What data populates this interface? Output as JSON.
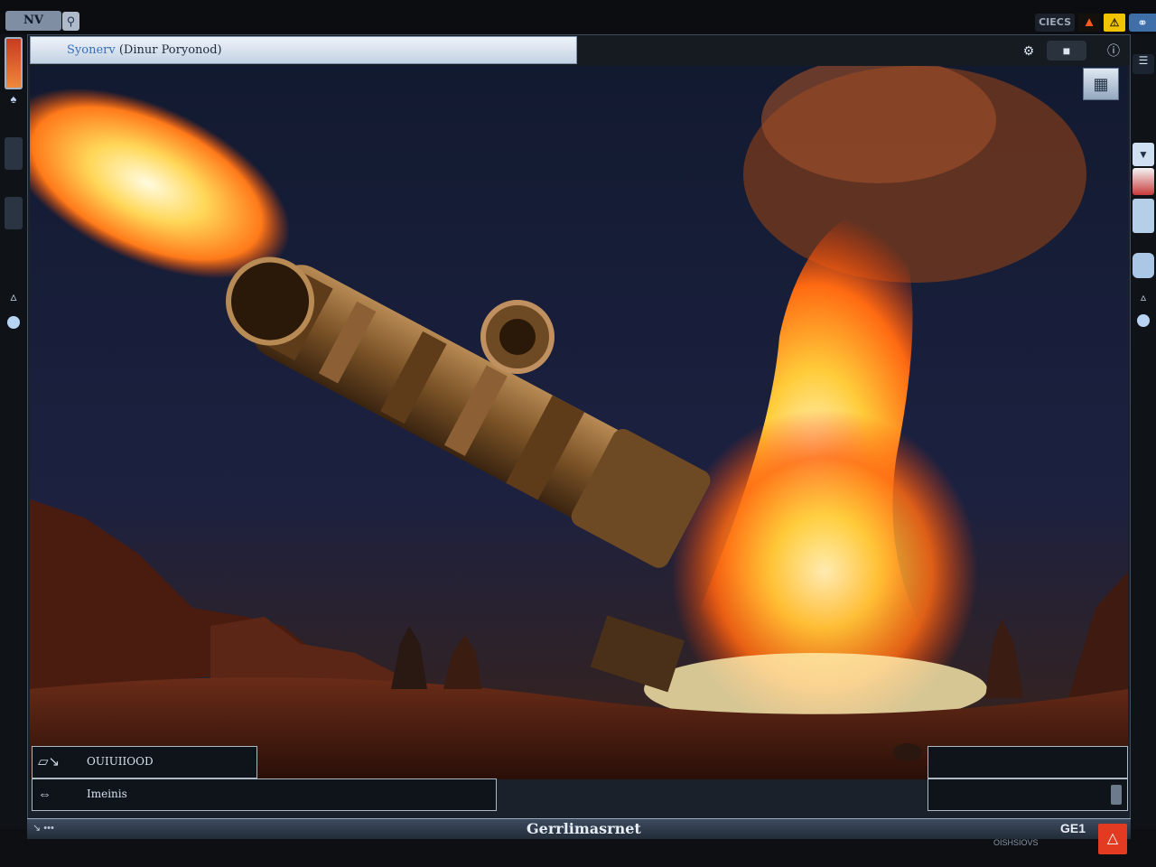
{
  "topbar": {
    "logo_text": "NV",
    "search_icon": "search-icon",
    "tray": {
      "label": "CIECS",
      "fire_icon": "fire-icon",
      "warning_icon": "warning-icon",
      "globe_icon": "globe-icon"
    }
  },
  "left_dock": {
    "items": [
      "app-icon",
      "user-icon",
      "panel-slot",
      "panel-slot",
      "hat-icon",
      "bubble-icon"
    ]
  },
  "window": {
    "tab_title_app": "Syonerv",
    "tab_title_doc": "(Dinur Poryonod)",
    "controls": [
      "settings-icon",
      "window-mode-icon",
      "info-icon"
    ]
  },
  "scene": {
    "corner_badge_icon": "frame-icon"
  },
  "panels": {
    "output_label": "OUIUIIOOD",
    "frames_label": "Imeinis"
  },
  "statusbar": {
    "left_text": "↘ •••",
    "center_text": "Gerrlimasrnet",
    "right_text": "GE1",
    "sub_text": "OISHSIOVS"
  },
  "colors": {
    "sky": "#141c33",
    "fire": "#ff8a1e",
    "ground": "#4a1f14",
    "accent": "#3a6fb3"
  }
}
